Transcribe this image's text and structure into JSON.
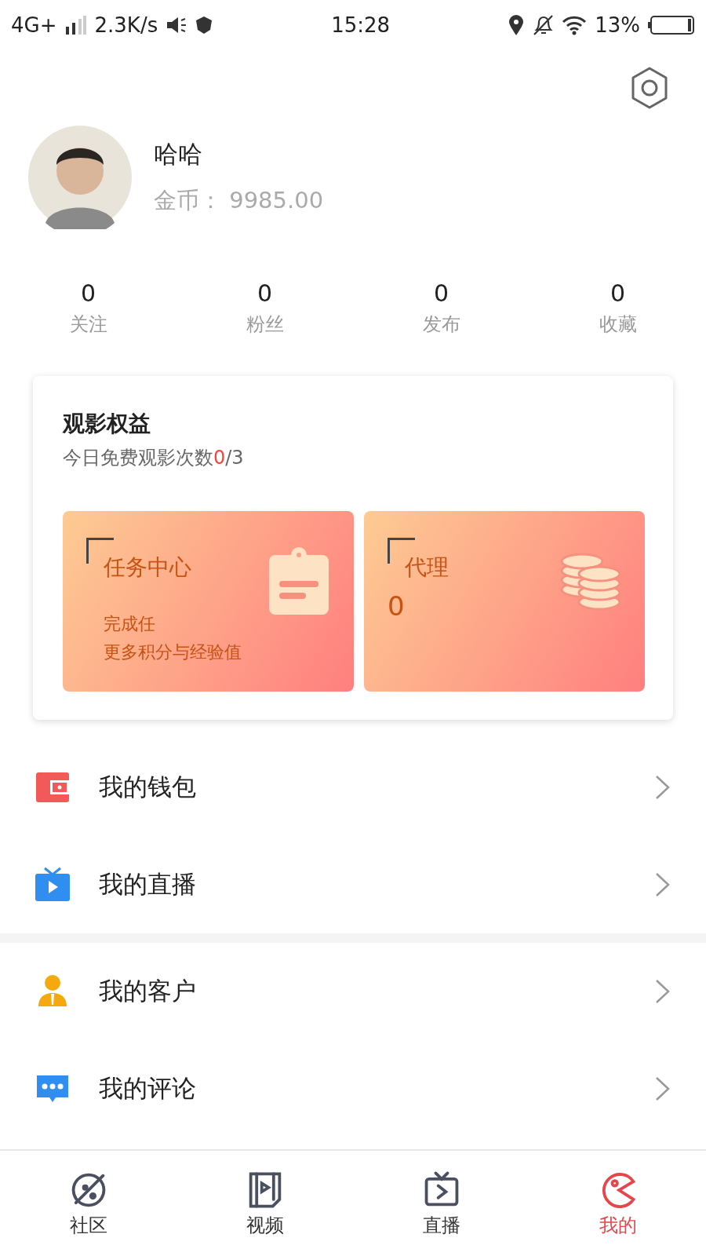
{
  "status_bar": {
    "network": "4G+",
    "speed": "2.3K/s",
    "time": "15:28",
    "battery": "13%"
  },
  "profile": {
    "name": "哈哈",
    "coins_label": "金币：",
    "coins": "9985.00"
  },
  "stats": [
    {
      "value": "0",
      "label": "关注"
    },
    {
      "value": "0",
      "label": "粉丝"
    },
    {
      "value": "0",
      "label": "发布"
    },
    {
      "value": "0",
      "label": "收藏"
    }
  ],
  "benefits": {
    "title": "观影权益",
    "subtitle_prefix": "今日免费观影次数",
    "used": "0",
    "total": "/3",
    "cards": [
      {
        "kind": "task",
        "title": "任务中心",
        "lines": [
          "完成任",
          "更多积分与经验值"
        ]
      },
      {
        "kind": "agent",
        "title": "代理",
        "lines": [
          "0"
        ]
      }
    ]
  },
  "menu_groups": [
    [
      {
        "kind": "wallet",
        "label": "我的钱包"
      },
      {
        "kind": "live",
        "label": "我的直播"
      }
    ],
    [
      {
        "kind": "customer",
        "label": "我的客户"
      },
      {
        "kind": "comment",
        "label": "我的评论"
      }
    ]
  ],
  "tabs": [
    {
      "kind": "community",
      "label": "社区",
      "selected": false
    },
    {
      "kind": "video",
      "label": "视频",
      "selected": false
    },
    {
      "kind": "live",
      "label": "直播",
      "selected": false
    },
    {
      "kind": "mine",
      "label": "我的",
      "selected": true
    }
  ]
}
